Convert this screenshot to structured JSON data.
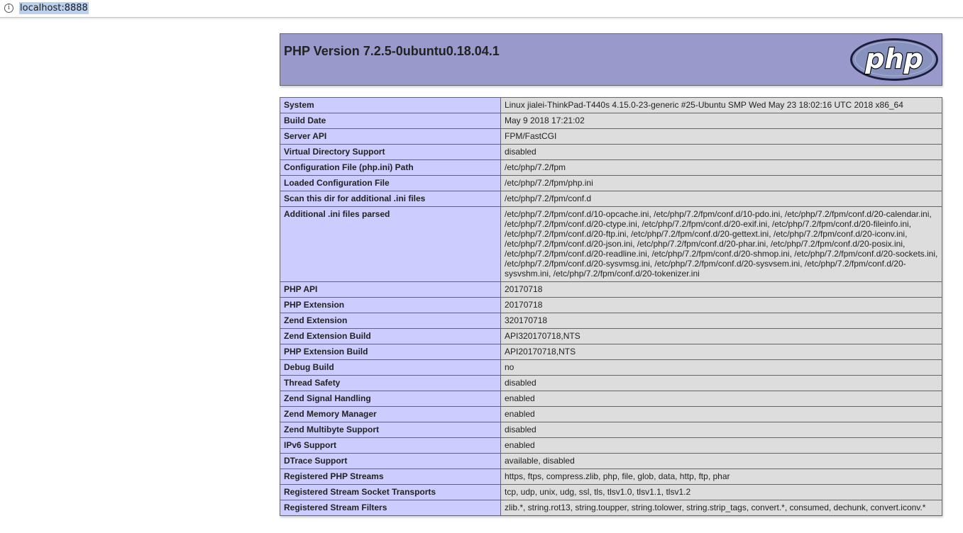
{
  "browser": {
    "url": "localhost:8888",
    "info_icon": "info-icon"
  },
  "header": {
    "title": "PHP Version 7.2.5-0ubuntu0.18.04.1",
    "logo_text": "php",
    "colors": {
      "header_bg": "#9999cc",
      "label_bg": "#ccccff",
      "value_bg": "#dddddd"
    }
  },
  "rows": [
    {
      "label": "System",
      "value": "Linux jialei-ThinkPad-T440s 4.15.0-23-generic #25-Ubuntu SMP Wed May 23 18:02:16 UTC 2018 x86_64"
    },
    {
      "label": "Build Date",
      "value": "May 9 2018 17:21:02"
    },
    {
      "label": "Server API",
      "value": "FPM/FastCGI"
    },
    {
      "label": "Virtual Directory Support",
      "value": "disabled"
    },
    {
      "label": "Configuration File (php.ini) Path",
      "value": "/etc/php/7.2/fpm"
    },
    {
      "label": "Loaded Configuration File",
      "value": "/etc/php/7.2/fpm/php.ini"
    },
    {
      "label": "Scan this dir for additional .ini files",
      "value": "/etc/php/7.2/fpm/conf.d"
    },
    {
      "label": "Additional .ini files parsed",
      "value": "/etc/php/7.2/fpm/conf.d/10-opcache.ini, /etc/php/7.2/fpm/conf.d/10-pdo.ini, /etc/php/7.2/fpm/conf.d/20-calendar.ini, /etc/php/7.2/fpm/conf.d/20-ctype.ini, /etc/php/7.2/fpm/conf.d/20-exif.ini, /etc/php/7.2/fpm/conf.d/20-fileinfo.ini, /etc/php/7.2/fpm/conf.d/20-ftp.ini, /etc/php/7.2/fpm/conf.d/20-gettext.ini, /etc/php/7.2/fpm/conf.d/20-iconv.ini, /etc/php/7.2/fpm/conf.d/20-json.ini, /etc/php/7.2/fpm/conf.d/20-phar.ini, /etc/php/7.2/fpm/conf.d/20-posix.ini, /etc/php/7.2/fpm/conf.d/20-readline.ini, /etc/php/7.2/fpm/conf.d/20-shmop.ini, /etc/php/7.2/fpm/conf.d/20-sockets.ini, /etc/php/7.2/fpm/conf.d/20-sysvmsg.ini, /etc/php/7.2/fpm/conf.d/20-sysvsem.ini, /etc/php/7.2/fpm/conf.d/20-sysvshm.ini, /etc/php/7.2/fpm/conf.d/20-tokenizer.ini"
    },
    {
      "label": "PHP API",
      "value": "20170718"
    },
    {
      "label": "PHP Extension",
      "value": "20170718"
    },
    {
      "label": "Zend Extension",
      "value": "320170718"
    },
    {
      "label": "Zend Extension Build",
      "value": "API320170718,NTS"
    },
    {
      "label": "PHP Extension Build",
      "value": "API20170718,NTS"
    },
    {
      "label": "Debug Build",
      "value": "no"
    },
    {
      "label": "Thread Safety",
      "value": "disabled"
    },
    {
      "label": "Zend Signal Handling",
      "value": "enabled"
    },
    {
      "label": "Zend Memory Manager",
      "value": "enabled"
    },
    {
      "label": "Zend Multibyte Support",
      "value": "disabled"
    },
    {
      "label": "IPv6 Support",
      "value": "enabled"
    },
    {
      "label": "DTrace Support",
      "value": "available, disabled"
    },
    {
      "label": "Registered PHP Streams",
      "value": "https, ftps, compress.zlib, php, file, glob, data, http, ftp, phar"
    },
    {
      "label": "Registered Stream Socket Transports",
      "value": "tcp, udp, unix, udg, ssl, tls, tlsv1.0, tlsv1.1, tlsv1.2"
    },
    {
      "label": "Registered Stream Filters",
      "value": "zlib.*, string.rot13, string.toupper, string.tolower, string.strip_tags, convert.*, consumed, dechunk, convert.iconv.*"
    }
  ]
}
